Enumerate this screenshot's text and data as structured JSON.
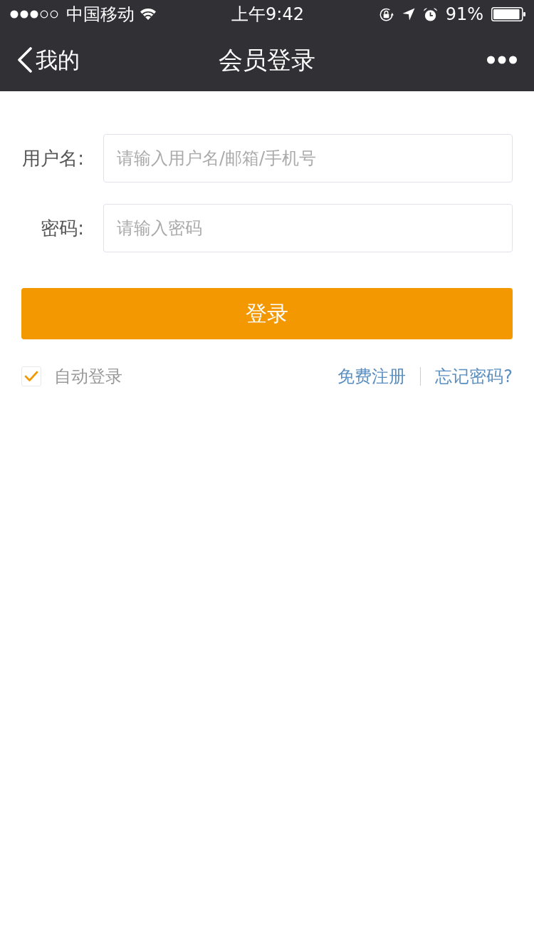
{
  "status_bar": {
    "carrier": "中国移动",
    "time": "上午9:42",
    "battery": "91%"
  },
  "nav_bar": {
    "back_label": "我的",
    "title": "会员登录"
  },
  "form": {
    "fields": [
      {
        "label": "用户名:",
        "placeholder": "请输入用户名/邮箱/手机号"
      },
      {
        "label": "密码:",
        "placeholder": "请输入密码"
      }
    ],
    "submit": "登录",
    "auto_login": {
      "label": "自动登录",
      "checked": true
    },
    "links": [
      "免费注册",
      "忘记密码?"
    ]
  }
}
